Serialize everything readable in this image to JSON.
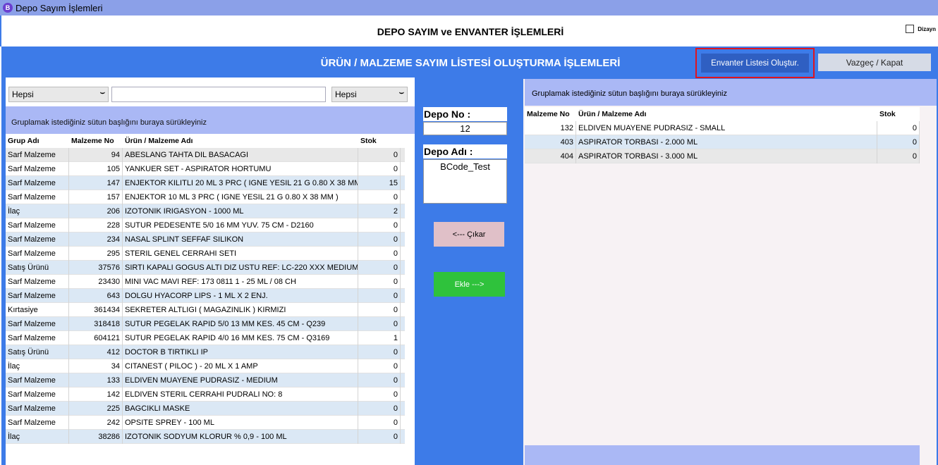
{
  "window": {
    "title": "Depo Sayım İşlemleri",
    "icon_letter": "B"
  },
  "header": {
    "title": "DEPO SAYIM ve ENVANTER İŞLEMLERİ",
    "dizayn_label": "Dizayn"
  },
  "panel": {
    "title": "ÜRÜN / MALZEME SAYIM LİSTESİ OLUŞTURMA İŞLEMLERİ",
    "btn_envanter": "Envanter Listesi Oluştur.",
    "btn_vazgec": "Vazgeç / Kapat"
  },
  "left": {
    "filter1": "Hepsi",
    "filter2": "Hepsi",
    "group_hint": "Gruplamak istediğiniz sütun başlığını buraya sürükleyiniz",
    "columns": [
      "Grup Adı",
      "Malzeme No",
      "Ürün / Malzeme Adı",
      "Stok"
    ],
    "rows": [
      [
        "Sarf Malzeme",
        "94",
        "ABESLANG TAHTA DIL BASACAGI",
        "0"
      ],
      [
        "Sarf Malzeme",
        "105",
        "YANKUER SET - ASPIRATOR HORTUMU",
        "0"
      ],
      [
        "Sarf Malzeme",
        "147",
        "ENJEKTOR KILITLI 20 ML 3 PRC ( IGNE YESIL 21 G 0.80 X 38 MM",
        "15"
      ],
      [
        "Sarf Malzeme",
        "157",
        "ENJEKTOR 10 ML 3 PRC ( IGNE YESIL 21 G 0.80 X 38 MM )",
        "0"
      ],
      [
        "İlaç",
        "206",
        "IZOTONIK IRIGASYON - 1000 ML",
        "2"
      ],
      [
        "Sarf Malzeme",
        "228",
        "SUTUR PEDESENTE 5/0 16 MM YUV. 75 CM - D2160",
        "0"
      ],
      [
        "Sarf Malzeme",
        "234",
        "NASAL SPLINT SEFFAF SILIKON",
        "0"
      ],
      [
        "Sarf Malzeme",
        "295",
        "STERIL GENEL CERRAHI SETI",
        "0"
      ],
      [
        "Satış Ürünü",
        "37576",
        "SIRTI KAPALI GOGUS ALTI DIZ USTU REF: LC-220 XXX MEDIUM",
        "0"
      ],
      [
        "Sarf Malzeme",
        "23430",
        "MINI VAC MAVI REF: 173 0811 1 - 25 ML / 08 CH",
        "0"
      ],
      [
        "Sarf Malzeme",
        "643",
        "DOLGU HYACORP LIPS - 1 ML X 2 ENJ.",
        "0"
      ],
      [
        "Kırtasiye",
        "361434",
        "SEKRETER ALTLIGI ( MAGAZINLIK ) KIRMIZI",
        "0"
      ],
      [
        "Sarf Malzeme",
        "318418",
        "SUTUR PEGELAK RAPID 5/0 13 MM KES. 45 CM - Q239",
        "0"
      ],
      [
        "Sarf Malzeme",
        "604121",
        "SUTUR PEGELAK RAPID 4/0 16 MM KES. 75 CM - Q3169",
        "1"
      ],
      [
        "Satış Ürünü",
        "412",
        "DOCTOR B TIRTIKLI IP",
        "0"
      ],
      [
        "İlaç",
        "34",
        "CITANEST ( PILOC ) - 20 ML X 1 AMP",
        "0"
      ],
      [
        "Sarf Malzeme",
        "133",
        "ELDIVEN MUAYENE PUDRASIZ - MEDIUM",
        "0"
      ],
      [
        "Sarf Malzeme",
        "142",
        "ELDIVEN STERIL CERRAHI PUDRALI NO: 8",
        "0"
      ],
      [
        "Sarf Malzeme",
        "225",
        "BAGCIKLI MASKE",
        "0"
      ],
      [
        "Sarf Malzeme",
        "242",
        "OPSITE SPREY - 100 ML",
        "0"
      ],
      [
        "İlaç",
        "38286",
        "IZOTONIK SODYUM KLORUR % 0,9 - 100 ML",
        "0"
      ]
    ]
  },
  "middle": {
    "depo_no_label": "Depo No :",
    "depo_no": "12",
    "depo_adi_label": "Depo Adı :",
    "depo_adi": "BCode_Test",
    "btn_cikar": "<--- Çıkar",
    "btn_ekle": "Ekle --->"
  },
  "right": {
    "group_hint": "Gruplamak istediğiniz sütun başlığını buraya sürükleyiniz",
    "columns": [
      "Malzeme No",
      "Ürün / Malzeme Adı",
      "Stok"
    ],
    "rows": [
      [
        "132",
        "ELDIVEN MUAYENE PUDRASIZ - SMALL",
        "0"
      ],
      [
        "403",
        "ASPIRATOR TORBASI - 2.000 ML",
        "0"
      ],
      [
        "404",
        "ASPIRATOR TORBASI - 3.000 ML",
        "0"
      ]
    ]
  },
  "colors": {
    "panel_blue": "#3d7be8",
    "titlebar": "#8ba0e8",
    "highlight_red": "#e0141e",
    "ekle_green": "#2fc23c"
  }
}
